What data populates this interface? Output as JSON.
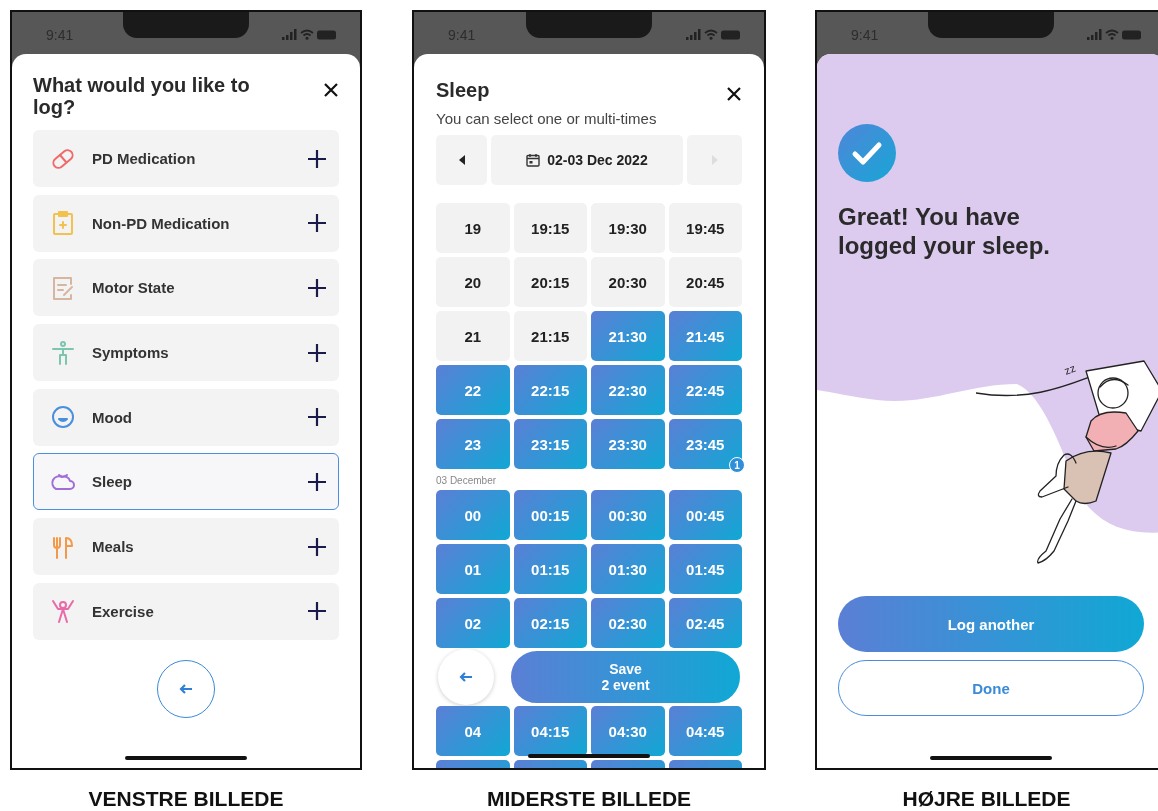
{
  "left_screen": {
    "status_time": "9:41",
    "title": "What would you like to log?",
    "items": [
      {
        "label": "PD Medication",
        "kind": "pill",
        "color": "#f06a6a",
        "selected": false
      },
      {
        "label": "Non-PD Medication",
        "kind": "clipboard",
        "color": "#f2c14e",
        "selected": false
      },
      {
        "label": "Motor State",
        "kind": "note",
        "color": "#d6b6a0",
        "selected": false
      },
      {
        "label": "Symptoms",
        "kind": "figure",
        "color": "#7cc5ae",
        "selected": false
      },
      {
        "label": "Mood",
        "kind": "face",
        "color": "#4a8fdc",
        "selected": false
      },
      {
        "label": "Sleep",
        "kind": "moon",
        "color": "#a06fd6",
        "selected": true
      },
      {
        "label": "Meals",
        "kind": "cutlery",
        "color": "#f29a4a",
        "selected": false
      },
      {
        "label": "Exercise",
        "kind": "exercise",
        "color": "#e86aa8",
        "selected": false
      }
    ]
  },
  "middle_screen": {
    "status_time": "9:41",
    "title": "Sleep",
    "subtitle": "You can select one or multi-times",
    "date_nav": {
      "label": "02-03 Dec 2022",
      "prev_disabled": false,
      "next_disabled": true
    },
    "sections": [
      {
        "rows": [
          {
            "kind": "slots",
            "cells": [
              {
                "label": "19",
                "selected": false
              },
              {
                "label": "19:15",
                "selected": false
              },
              {
                "label": "19:30",
                "selected": false
              },
              {
                "label": "19:45",
                "selected": false
              }
            ]
          },
          {
            "kind": "slots",
            "cells": [
              {
                "label": "20",
                "selected": false
              },
              {
                "label": "20:15",
                "selected": false
              },
              {
                "label": "20:30",
                "selected": false
              },
              {
                "label": "20:45",
                "selected": false
              }
            ]
          },
          {
            "kind": "slots",
            "cells": [
              {
                "label": "21",
                "selected": false
              },
              {
                "label": "21:15",
                "selected": false
              },
              {
                "label": "21:30",
                "selected": true
              },
              {
                "label": "21:45",
                "selected": true
              }
            ]
          },
          {
            "kind": "slots",
            "cells": [
              {
                "label": "22",
                "selected": true
              },
              {
                "label": "22:15",
                "selected": true
              },
              {
                "label": "22:30",
                "selected": true
              },
              {
                "label": "22:45",
                "selected": true
              }
            ]
          },
          {
            "kind": "slots",
            "cells": [
              {
                "label": "23",
                "selected": true
              },
              {
                "label": "23:15",
                "selected": true
              },
              {
                "label": "23:30",
                "selected": true
              },
              {
                "label": "23:45",
                "selected": true,
                "badge": "1"
              }
            ]
          }
        ]
      },
      {
        "heading": "03 December",
        "rows": [
          {
            "kind": "slots",
            "cells": [
              {
                "label": "00",
                "selected": true
              },
              {
                "label": "00:15",
                "selected": true
              },
              {
                "label": "00:30",
                "selected": true
              },
              {
                "label": "00:45",
                "selected": true
              }
            ]
          },
          {
            "kind": "slots",
            "cells": [
              {
                "label": "01",
                "selected": true
              },
              {
                "label": "01:15",
                "selected": true
              },
              {
                "label": "01:30",
                "selected": true
              },
              {
                "label": "01:45",
                "selected": true
              }
            ]
          },
          {
            "kind": "slots",
            "cells": [
              {
                "label": "02",
                "selected": true
              },
              {
                "label": "02:15",
                "selected": true
              },
              {
                "label": "02:30",
                "selected": true
              },
              {
                "label": "02:45",
                "selected": true
              }
            ]
          },
          {
            "kind": "actions",
            "save_lines": [
              "Save",
              "2 event"
            ]
          },
          {
            "kind": "slots",
            "cells": [
              {
                "label": "04",
                "selected": true
              },
              {
                "label": "04:15",
                "selected": true
              },
              {
                "label": "04:30",
                "selected": true
              },
              {
                "label": "04:45",
                "selected": true
              }
            ]
          },
          {
            "kind": "slots",
            "cells": [
              {
                "selected": true
              },
              {
                "selected": true
              },
              {
                "selected": true
              },
              {
                "selected": true
              }
            ]
          }
        ]
      }
    ]
  },
  "right_screen": {
    "status_time": "9:41",
    "message": "Great! You have logged your sleep.",
    "snore": "zz",
    "buttons": [
      {
        "label": "Log another",
        "kind": "primary"
      },
      {
        "label": "Done",
        "kind": "outline"
      }
    ]
  },
  "captions": [
    "VENSTRE BILLEDE",
    "MIDERSTE BILLEDE",
    "HØJRE BILLEDE"
  ]
}
